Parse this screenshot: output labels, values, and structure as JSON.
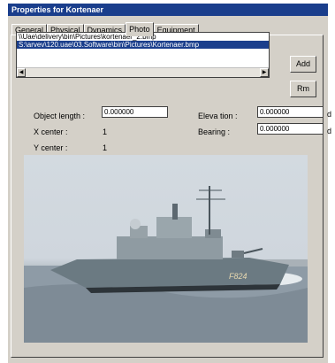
{
  "window": {
    "title": "Properties for Kortenaer"
  },
  "tabs": [
    {
      "label": "General"
    },
    {
      "label": "Physical"
    },
    {
      "label": "Dynamics"
    },
    {
      "label": "Photo",
      "active": true
    },
    {
      "label": "Equipment"
    }
  ],
  "photo_list": {
    "items": [
      "\\\\Uae\\delivery\\bin\\Pictures\\kortenaer_2.bmp",
      "S:\\arvev\\120.uae\\03.Software\\bin\\Pictures\\Kortenaer.bmp"
    ],
    "selected_index": 1
  },
  "buttons": {
    "add": "Add",
    "remove": "Rm"
  },
  "fields": {
    "object_length": {
      "label": "Object length :",
      "value": "0.000000"
    },
    "elevation": {
      "label": "Eleva tion :",
      "value": "0.000000",
      "unit": "d"
    },
    "bearing": {
      "label": "Bearing :",
      "value": "0.000000",
      "unit": "d"
    },
    "x_center": {
      "label": "X center :",
      "value": "1"
    },
    "y_center": {
      "label": "Y center :",
      "value": "1"
    }
  },
  "photo": {
    "hull_number": "F824"
  },
  "colors": {
    "titlebar": "#1a3e8c",
    "dialog": "#d4d0c8",
    "selection": "#1a3e8c"
  }
}
